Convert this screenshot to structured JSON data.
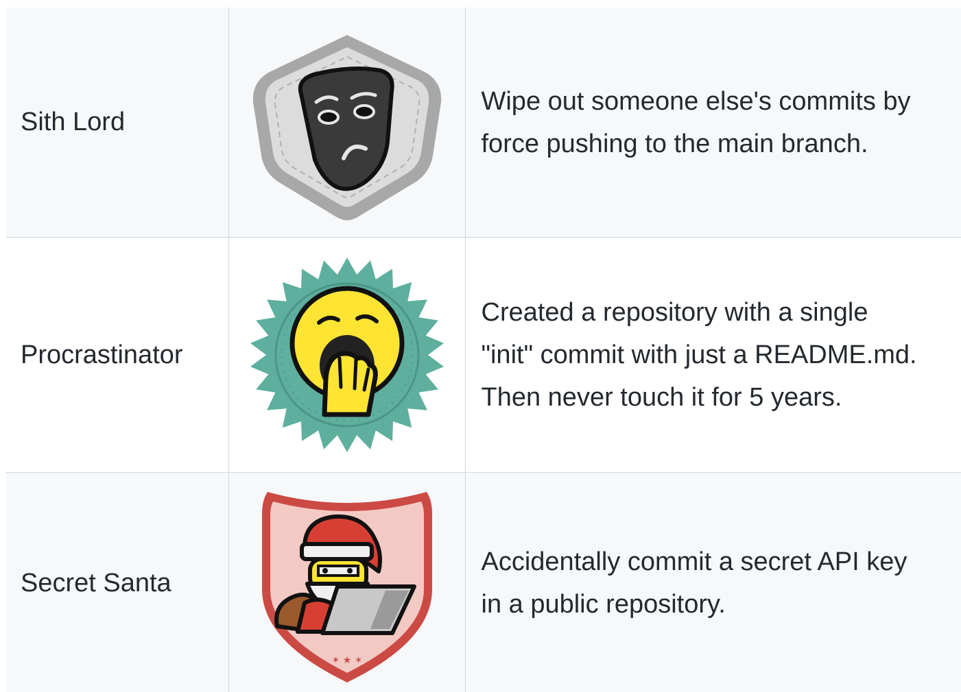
{
  "rows": [
    {
      "name": "Sith Lord",
      "badge_icon": "tragedy-mask-badge-icon",
      "description_lines": [
        "Wipe out someone else's commits by",
        "force pushing to the main branch."
      ]
    },
    {
      "name": "Procrastinator",
      "badge_icon": "yawning-face-badge-icon",
      "description_lines": [
        "Created a repository with a single",
        "\"init\" commit with just a README.md.",
        "Then never touch it for 5 years."
      ]
    },
    {
      "name": "Secret Santa",
      "badge_icon": "santa-laptop-badge-icon",
      "description_lines": [
        "Accidentally commit a secret API key",
        "in a public repository."
      ]
    }
  ],
  "colors": {
    "row_alt_background": "#f6f8fa",
    "border": "#d0d7de",
    "text": "#24292f"
  }
}
